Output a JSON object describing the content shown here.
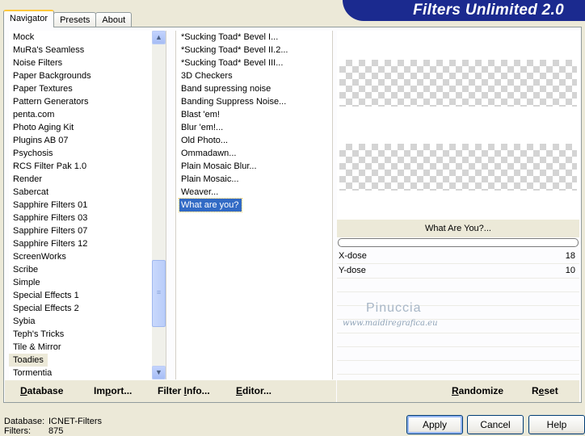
{
  "tabs": [
    "Navigator",
    "Presets",
    "About"
  ],
  "banner": "Filters Unlimited 2.0",
  "categories": [
    "Mock",
    "MuRa's Seamless",
    "Noise Filters",
    "Paper Backgrounds",
    "Paper Textures",
    "Pattern Generators",
    "penta.com",
    "Photo Aging Kit",
    "Plugins AB 07",
    "Psychosis",
    "RCS Filter Pak 1.0",
    "Render",
    "Sabercat",
    "Sapphire Filters 01",
    "Sapphire Filters 03",
    "Sapphire Filters 07",
    "Sapphire Filters 12",
    "ScreenWorks",
    "Scribe",
    "Simple",
    "Special Effects 1",
    "Special Effects 2",
    "Sybia",
    "Teph's Tricks",
    "Tile & Mirror",
    "Toadies",
    "Tormentia"
  ],
  "selected_category": "Toadies",
  "filters": [
    "*Sucking Toad*  Bevel I...",
    "*Sucking Toad*  Bevel II.2...",
    "*Sucking Toad*  Bevel III...",
    "3D Checkers",
    "Band supressing noise",
    "Banding Suppress Noise...",
    "Blast 'em!",
    "Blur 'em!...",
    "Old Photo...",
    "Ommadawn...",
    "Plain Mosaic Blur...",
    "Plain Mosaic...",
    "Weaver...",
    "What are you?"
  ],
  "selected_filter": "What are you?",
  "filter_title": "What Are You?...",
  "params": [
    {
      "label": "X-dose",
      "value": "18"
    },
    {
      "label": "Y-dose",
      "value": "10"
    }
  ],
  "watermark": {
    "name": "Pinuccia",
    "url": "www.maidiregrafica.eu"
  },
  "bottom_left": {
    "database": {
      "pre": "",
      "u": "D",
      "post": "atabase"
    },
    "import": {
      "pre": "Im",
      "u": "p",
      "post": "ort..."
    },
    "filter_info": {
      "pre": "Filter ",
      "u": "I",
      "post": "nfo..."
    },
    "editor": {
      "pre": "",
      "u": "E",
      "post": "ditor..."
    }
  },
  "bottom_right": {
    "randomize": {
      "pre": "",
      "u": "R",
      "post": "andomize"
    },
    "reset": {
      "pre": "R",
      "u": "e",
      "post": "set"
    }
  },
  "status": {
    "database_label": "Database:",
    "database_value": "ICNET-Filters",
    "filters_label": "Filters:",
    "filters_value": "875"
  },
  "buttons": {
    "apply": "Apply",
    "cancel": "Cancel",
    "help": "Help"
  }
}
